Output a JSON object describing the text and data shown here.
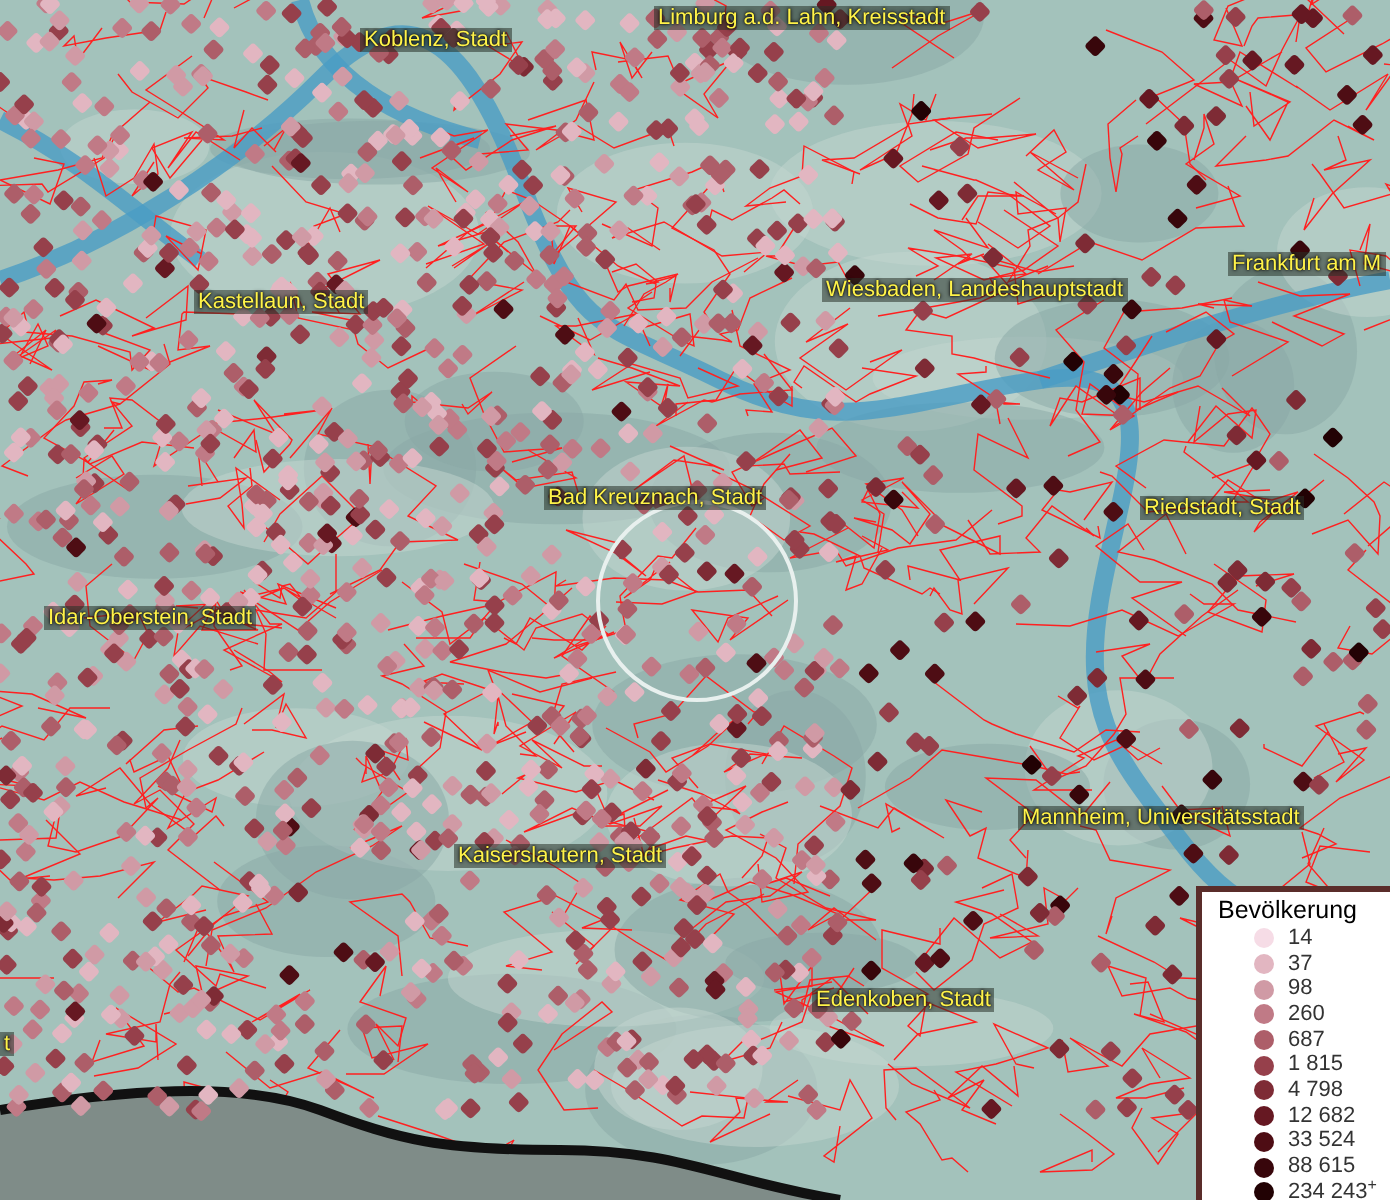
{
  "map": {
    "places": [
      {
        "label": "Limburg a.d. Lahn, Kreisstadt"
      },
      {
        "label": "Koblenz, Stadt"
      },
      {
        "label": "Frankfurt am M"
      },
      {
        "label": "Wiesbaden, Landeshauptstadt"
      },
      {
        "label": "Kastellaun, Stadt"
      },
      {
        "label": "Bad Kreuznach, Stadt"
      },
      {
        "label": "Riedstadt, Stadt"
      },
      {
        "label": "Idar-Oberstein, Stadt"
      },
      {
        "label": "Mannheim, Universitätsstadt"
      },
      {
        "label": "Kaiserslautern, Stadt"
      },
      {
        "label": "Edenkoben, Stadt"
      },
      {
        "label": "t"
      }
    ]
  },
  "legend": {
    "title": "Bevölkerung",
    "items": [
      {
        "value": "14",
        "color": "#f6dce6"
      },
      {
        "value": "37",
        "color": "#e2b6c1"
      },
      {
        "value": "98",
        "color": "#d09aa5"
      },
      {
        "value": "260",
        "color": "#c07a86"
      },
      {
        "value": "687",
        "color": "#ad5e69"
      },
      {
        "value": "1 815",
        "color": "#96404b"
      },
      {
        "value": "4 798",
        "color": "#7e2b35"
      },
      {
        "value": "12 682",
        "color": "#661822"
      },
      {
        "value": "33 524",
        "color": "#4e0d14"
      },
      {
        "value": "88 615",
        "color": "#38060b"
      },
      {
        "value": "234 243$^{+}$",
        "color": "#220204"
      }
    ]
  }
}
